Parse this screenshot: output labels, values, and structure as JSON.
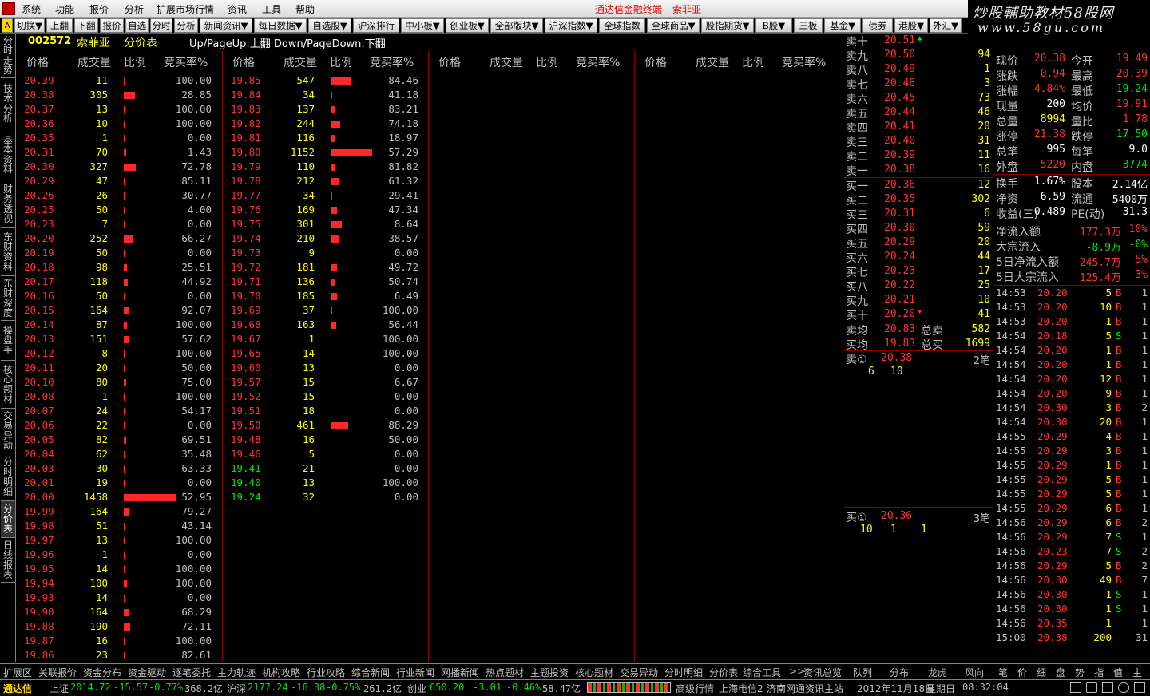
{
  "menu": {
    "items": [
      "系统",
      "功能",
      "报价",
      "分析",
      "扩展市场行情",
      "资讯",
      "工具",
      "帮助"
    ],
    "center_title": "通达信金融终端",
    "center_stock": "索菲亚"
  },
  "brand": {
    "line1": "炒股輔助教材58股网",
    "line2": "www.58gu.com"
  },
  "toolbar": {
    "items": [
      "切换▼",
      "上翻",
      "下翻",
      "报价",
      "自选",
      "分时",
      "分析",
      "新闻资讯▼",
      "每日数据▼",
      "自选股▼",
      "沪深排行",
      "中小板▼",
      "创业板▼",
      "全部版块▼",
      "沪深指数▼",
      "全球指数",
      "全球商品▼",
      "股指期货▼",
      "B股▼",
      "三板",
      "基金▼",
      "债券",
      "港股▼",
      "外汇▼"
    ]
  },
  "left_tabs": [
    "分时走势",
    "技术分析",
    "基本资料",
    "财务透视",
    "东财资料",
    "东财深度",
    "操盘手",
    "核心题材",
    "交易异动",
    "分时明细",
    "分价表",
    "日线报表"
  ],
  "header": {
    "code": "002572",
    "name": "索菲亚",
    "title": "分价表",
    "hint": "Up/PageUp:上翻 Down/PageDown:下翻"
  },
  "columns": {
    "price": "价格",
    "volume": "成交量",
    "ratio": "比例",
    "bid_rate": "竞买率%"
  },
  "col1": [
    {
      "p": "20.39",
      "v": "11",
      "r": "100.00",
      "c": "red",
      "b": 1
    },
    {
      "p": "20.38",
      "v": "305",
      "r": "28.85",
      "c": "red",
      "b": 14
    },
    {
      "p": "20.37",
      "v": "13",
      "r": "100.00",
      "c": "red",
      "b": 1
    },
    {
      "p": "20.36",
      "v": "10",
      "r": "100.00",
      "c": "red",
      "b": 1
    },
    {
      "p": "20.35",
      "v": "1",
      "r": "0.00",
      "c": "red",
      "b": 1
    },
    {
      "p": "20.31",
      "v": "70",
      "r": "1.43",
      "c": "red",
      "b": 3
    },
    {
      "p": "20.30",
      "v": "327",
      "r": "72.78",
      "c": "red",
      "b": 15
    },
    {
      "p": "20.29",
      "v": "47",
      "r": "85.11",
      "c": "red",
      "b": 2
    },
    {
      "p": "20.26",
      "v": "26",
      "r": "30.77",
      "c": "red",
      "b": 1
    },
    {
      "p": "20.25",
      "v": "50",
      "r": "4.00",
      "c": "red",
      "b": 2
    },
    {
      "p": "20.23",
      "v": "7",
      "r": "0.00",
      "c": "red",
      "b": 1
    },
    {
      "p": "20.20",
      "v": "252",
      "r": "66.27",
      "c": "red",
      "b": 11
    },
    {
      "p": "20.19",
      "v": "50",
      "r": "0.00",
      "c": "red",
      "b": 2
    },
    {
      "p": "20.18",
      "v": "98",
      "r": "25.51",
      "c": "red",
      "b": 4
    },
    {
      "p": "20.17",
      "v": "118",
      "r": "44.92",
      "c": "red",
      "b": 5
    },
    {
      "p": "20.16",
      "v": "50",
      "r": "0.00",
      "c": "red",
      "b": 2
    },
    {
      "p": "20.15",
      "v": "164",
      "r": "92.07",
      "c": "red",
      "b": 7
    },
    {
      "p": "20.14",
      "v": "87",
      "r": "100.00",
      "c": "red",
      "b": 4
    },
    {
      "p": "20.13",
      "v": "151",
      "r": "57.62",
      "c": "red",
      "b": 7
    },
    {
      "p": "20.12",
      "v": "8",
      "r": "100.00",
      "c": "red",
      "b": 1
    },
    {
      "p": "20.11",
      "v": "20",
      "r": "50.00",
      "c": "red",
      "b": 1
    },
    {
      "p": "20.10",
      "v": "80",
      "r": "75.00",
      "c": "red",
      "b": 3
    },
    {
      "p": "20.08",
      "v": "1",
      "r": "100.00",
      "c": "red",
      "b": 1
    },
    {
      "p": "20.07",
      "v": "24",
      "r": "54.17",
      "c": "red",
      "b": 1
    },
    {
      "p": "20.06",
      "v": "22",
      "r": "0.00",
      "c": "red",
      "b": 1
    },
    {
      "p": "20.05",
      "v": "82",
      "r": "69.51",
      "c": "red",
      "b": 3
    },
    {
      "p": "20.04",
      "v": "62",
      "r": "35.48",
      "c": "red",
      "b": 2
    },
    {
      "p": "20.03",
      "v": "30",
      "r": "63.33",
      "c": "red",
      "b": 1
    },
    {
      "p": "20.01",
      "v": "19",
      "r": "0.00",
      "c": "red",
      "b": 1
    },
    {
      "p": "20.00",
      "v": "1458",
      "r": "52.95",
      "c": "red",
      "b": 65
    },
    {
      "p": "19.99",
      "v": "164",
      "r": "79.27",
      "c": "red",
      "b": 7
    },
    {
      "p": "19.98",
      "v": "51",
      "r": "43.14",
      "c": "red",
      "b": 2
    },
    {
      "p": "19.97",
      "v": "13",
      "r": "100.00",
      "c": "red",
      "b": 1
    },
    {
      "p": "19.96",
      "v": "1",
      "r": "0.00",
      "c": "red",
      "b": 1
    },
    {
      "p": "19.95",
      "v": "14",
      "r": "100.00",
      "c": "red",
      "b": 1
    },
    {
      "p": "19.94",
      "v": "100",
      "r": "100.00",
      "c": "red",
      "b": 4
    },
    {
      "p": "19.93",
      "v": "14",
      "r": "0.00",
      "c": "red",
      "b": 1
    },
    {
      "p": "19.90",
      "v": "164",
      "r": "68.29",
      "c": "red",
      "b": 7
    },
    {
      "p": "19.88",
      "v": "190",
      "r": "72.11",
      "c": "red",
      "b": 8
    },
    {
      "p": "19.87",
      "v": "16",
      "r": "100.00",
      "c": "red",
      "b": 1
    },
    {
      "p": "19.86",
      "v": "23",
      "r": "82.61",
      "c": "red",
      "b": 1
    }
  ],
  "col2": [
    {
      "p": "19.85",
      "v": "547",
      "r": "84.46",
      "c": "red",
      "b": 26
    },
    {
      "p": "19.84",
      "v": "34",
      "r": "41.18",
      "c": "red",
      "b": 2
    },
    {
      "p": "19.83",
      "v": "137",
      "r": "83.21",
      "c": "red",
      "b": 6
    },
    {
      "p": "19.82",
      "v": "244",
      "r": "74.18",
      "c": "red",
      "b": 12
    },
    {
      "p": "19.81",
      "v": "116",
      "r": "18.97",
      "c": "red",
      "b": 5
    },
    {
      "p": "19.80",
      "v": "1152",
      "r": "57.29",
      "c": "red",
      "b": 52
    },
    {
      "p": "19.79",
      "v": "110",
      "r": "81.82",
      "c": "red",
      "b": 5
    },
    {
      "p": "19.78",
      "v": "212",
      "r": "61.32",
      "c": "red",
      "b": 10
    },
    {
      "p": "19.77",
      "v": "34",
      "r": "29.41",
      "c": "red",
      "b": 2
    },
    {
      "p": "19.76",
      "v": "169",
      "r": "47.34",
      "c": "red",
      "b": 8
    },
    {
      "p": "19.75",
      "v": "301",
      "r": "8.64",
      "c": "red",
      "b": 14
    },
    {
      "p": "19.74",
      "v": "210",
      "r": "38.57",
      "c": "red",
      "b": 10
    },
    {
      "p": "19.73",
      "v": "9",
      "r": "0.00",
      "c": "red",
      "b": 1
    },
    {
      "p": "19.72",
      "v": "181",
      "r": "49.72",
      "c": "red",
      "b": 8
    },
    {
      "p": "19.71",
      "v": "136",
      "r": "50.74",
      "c": "red",
      "b": 6
    },
    {
      "p": "19.70",
      "v": "185",
      "r": "6.49",
      "c": "red",
      "b": 8
    },
    {
      "p": "19.69",
      "v": "37",
      "r": "100.00",
      "c": "red",
      "b": 2
    },
    {
      "p": "19.68",
      "v": "163",
      "r": "56.44",
      "c": "red",
      "b": 7
    },
    {
      "p": "19.67",
      "v": "1",
      "r": "100.00",
      "c": "red",
      "b": 1
    },
    {
      "p": "19.65",
      "v": "14",
      "r": "100.00",
      "c": "red",
      "b": 1
    },
    {
      "p": "19.60",
      "v": "13",
      "r": "0.00",
      "c": "red",
      "b": 1
    },
    {
      "p": "19.57",
      "v": "15",
      "r": "6.67",
      "c": "red",
      "b": 1
    },
    {
      "p": "19.52",
      "v": "15",
      "r": "0.00",
      "c": "red",
      "b": 1
    },
    {
      "p": "19.51",
      "v": "18",
      "r": "0.00",
      "c": "red",
      "b": 1
    },
    {
      "p": "19.50",
      "v": "461",
      "r": "88.29",
      "c": "red",
      "b": 22
    },
    {
      "p": "19.48",
      "v": "16",
      "r": "50.00",
      "c": "red",
      "b": 1
    },
    {
      "p": "19.46",
      "v": "5",
      "r": "0.00",
      "c": "red",
      "b": 1
    },
    {
      "p": "19.41",
      "v": "21",
      "r": "0.00",
      "c": "green",
      "b": 1
    },
    {
      "p": "19.40",
      "v": "13",
      "r": "100.00",
      "c": "green",
      "b": 1
    },
    {
      "p": "19.24",
      "v": "32",
      "r": "0.00",
      "c": "green",
      "b": 1
    }
  ],
  "book": {
    "asks": [
      {
        "l": "卖十",
        "p": "20.51",
        "v": "",
        "arrow": "▲"
      },
      {
        "l": "卖九",
        "p": "20.50",
        "v": "94"
      },
      {
        "l": "卖八",
        "p": "20.49",
        "v": "1"
      },
      {
        "l": "卖七",
        "p": "20.48",
        "v": "3"
      },
      {
        "l": "卖六",
        "p": "20.45",
        "v": "73"
      },
      {
        "l": "卖五",
        "p": "20.44",
        "v": "46"
      },
      {
        "l": "卖四",
        "p": "20.41",
        "v": "20"
      },
      {
        "l": "卖三",
        "p": "20.40",
        "v": "31"
      },
      {
        "l": "卖二",
        "p": "20.39",
        "v": "11"
      },
      {
        "l": "卖一",
        "p": "20.38",
        "v": "16"
      }
    ],
    "bids": [
      {
        "l": "买一",
        "p": "20.36",
        "v": "12"
      },
      {
        "l": "买二",
        "p": "20.35",
        "v": "302"
      },
      {
        "l": "买三",
        "p": "20.31",
        "v": "6"
      },
      {
        "l": "买四",
        "p": "20.30",
        "v": "59"
      },
      {
        "l": "买五",
        "p": "20.29",
        "v": "20"
      },
      {
        "l": "买六",
        "p": "20.24",
        "v": "44"
      },
      {
        "l": "买七",
        "p": "20.23",
        "v": "17"
      },
      {
        "l": "买八",
        "p": "20.22",
        "v": "25"
      },
      {
        "l": "买九",
        "p": "20.21",
        "v": "10"
      },
      {
        "l": "买十",
        "p": "20.20",
        "v": "41",
        "arrow": "▼"
      }
    ],
    "avg_sell_label": "卖均",
    "avg_sell": "20.83",
    "total_sell_label": "总卖",
    "total_sell": "582",
    "avg_buy_label": "买均",
    "avg_buy": "19.83",
    "total_buy_label": "总买",
    "total_buy": "1699",
    "q_sell_label": "卖①",
    "q_sell_price": "20.38",
    "q_sell_count": "2笔",
    "q_sell_orders": [
      "6",
      "10"
    ],
    "q_buy_label": "买①",
    "q_buy_price": "20.36",
    "q_buy_count": "3笔",
    "q_buy_orders": [
      "10",
      "1",
      "1"
    ]
  },
  "quote": {
    "rows": [
      {
        "a": "现价",
        "av": "20.38",
        "ac": "red",
        "b": "今开",
        "bv": "19.49",
        "bc": "red"
      },
      {
        "a": "涨跌",
        "av": "0.94",
        "ac": "red",
        "b": "最高",
        "bv": "20.39",
        "bc": "red"
      },
      {
        "a": "涨幅",
        "av": "4.84%",
        "ac": "red",
        "b": "最低",
        "bv": "19.24",
        "bc": "green"
      },
      {
        "a": "现量",
        "av": "200",
        "ac": "white",
        "b": "均价",
        "bv": "19.91",
        "bc": "red"
      },
      {
        "a": "总量",
        "av": "8994",
        "ac": "yellow",
        "b": "量比",
        "bv": "1.78",
        "bc": "red"
      },
      {
        "a": "涨停",
        "av": "21.38",
        "ac": "red",
        "b": "跌停",
        "bv": "17.50",
        "bc": "green"
      },
      {
        "a": "总笔",
        "av": "995",
        "ac": "white",
        "b": "每笔",
        "bv": "9.0",
        "bc": "white"
      },
      {
        "a": "外盘",
        "av": "5220",
        "ac": "red",
        "b": "内盘",
        "bv": "3774",
        "bc": "green"
      },
      {
        "a": "换手",
        "av": "1.67%",
        "ac": "white",
        "b": "股本",
        "bv": "2.14亿",
        "bc": "white"
      },
      {
        "a": "净资",
        "av": "6.59",
        "ac": "white",
        "b": "流通",
        "bv": "5400万",
        "bc": "white"
      },
      {
        "a": "收益(三)",
        "av": "0.489",
        "ac": "white",
        "b": "PE(动)",
        "bv": "31.3",
        "bc": "white"
      }
    ],
    "flow": [
      {
        "l": "净流入额",
        "v": "177.3万",
        "vc": "red",
        "p": "10%",
        "pc": "red"
      },
      {
        "l": "大宗流入",
        "v": "-8.9万",
        "vc": "green",
        "p": "-0%",
        "pc": "green"
      },
      {
        "l": "5日净流入额",
        "v": "245.7万",
        "vc": "red",
        "p": "5%",
        "pc": "red"
      },
      {
        "l": "5日大宗流入",
        "v": "125.4万",
        "vc": "red",
        "p": "3%",
        "pc": "red"
      }
    ]
  },
  "ticks": [
    {
      "t": "14:53",
      "p": "20.20",
      "v": "5",
      "d": "B",
      "n": "1"
    },
    {
      "t": "14:53",
      "p": "20.20",
      "v": "10",
      "d": "B",
      "n": "1"
    },
    {
      "t": "14:53",
      "p": "20.20",
      "v": "1",
      "d": "B",
      "n": "1"
    },
    {
      "t": "14:54",
      "p": "20.18",
      "v": "5",
      "d": "S",
      "n": "1"
    },
    {
      "t": "14:54",
      "p": "20.20",
      "v": "1",
      "d": "B",
      "n": "1"
    },
    {
      "t": "14:54",
      "p": "20.20",
      "v": "1",
      "d": "B",
      "n": "1"
    },
    {
      "t": "14:54",
      "p": "20.20",
      "v": "12",
      "d": "B",
      "n": "1"
    },
    {
      "t": "14:54",
      "p": "20.20",
      "v": "9",
      "d": "B",
      "n": "1"
    },
    {
      "t": "14:54",
      "p": "20.30",
      "v": "3",
      "d": "B",
      "n": "2"
    },
    {
      "t": "14:54",
      "p": "20.30",
      "v": "20",
      "d": "B",
      "n": "1"
    },
    {
      "t": "14:55",
      "p": "20.29",
      "v": "4",
      "d": "B",
      "n": "1"
    },
    {
      "t": "14:55",
      "p": "20.29",
      "v": "3",
      "d": "B",
      "n": "1"
    },
    {
      "t": "14:55",
      "p": "20.29",
      "v": "1",
      "d": "B",
      "n": "1"
    },
    {
      "t": "14:55",
      "p": "20.29",
      "v": "5",
      "d": "B",
      "n": "1"
    },
    {
      "t": "14:55",
      "p": "20.29",
      "v": "5",
      "d": "B",
      "n": "1"
    },
    {
      "t": "14:55",
      "p": "20.29",
      "v": "6",
      "d": "B",
      "n": "1"
    },
    {
      "t": "14:56",
      "p": "20.29",
      "v": "6",
      "d": "B",
      "n": "2"
    },
    {
      "t": "14:56",
      "p": "20.29",
      "v": "7",
      "d": "S",
      "n": "1"
    },
    {
      "t": "14:56",
      "p": "20.23",
      "v": "7",
      "d": "S",
      "n": "2"
    },
    {
      "t": "14:56",
      "p": "20.29",
      "v": "5",
      "d": "B",
      "n": "2"
    },
    {
      "t": "14:56",
      "p": "20.30",
      "v": "49",
      "d": "B",
      "n": "7"
    },
    {
      "t": "14:56",
      "p": "20.30",
      "v": "1",
      "d": "S",
      "n": "1"
    },
    {
      "t": "14:56",
      "p": "20.30",
      "v": "1",
      "d": "S",
      "n": "1"
    },
    {
      "t": "14:56",
      "p": "20.35",
      "v": "1",
      "d": "",
      "n": "1"
    },
    {
      "t": "15:00",
      "p": "20.38",
      "v": "200",
      "d": "",
      "n": "31"
    }
  ],
  "bottom_tabs": [
    "扩展区",
    "关联报价",
    "资金分布",
    "资金驱动",
    "逐笔委托",
    "主力轨迹",
    "机构攻略",
    "行业攻略",
    "综合新闻",
    "行业新闻",
    "网播新闻",
    "热点题材",
    "主题投资",
    "核心题材",
    "交易异动",
    "分时明细",
    "分价表",
    "综合工具",
    ">>",
    "资讯总览"
  ],
  "right_tabs": [
    "队列",
    "分布",
    "龙虎",
    "风向"
  ],
  "mini_tabs": [
    "笔",
    "价",
    "细",
    "盘",
    "势",
    "指",
    "值",
    "主"
  ],
  "status": {
    "app": "通达信",
    "sh_label": "上证",
    "sh_val": "2014.72",
    "sh_chg": "-15.57",
    "sh_pct": "-0.77%",
    "sh_amt": "368.2亿",
    "sz_label": "沪深",
    "sz_val": "2177.24",
    "sz_chg": "-16.38",
    "sz_pct": "-0.75%",
    "sz_amt": "261.2亿",
    "cy_label": "创业",
    "cy_val": "650.20",
    "cy_chg": "-3.01",
    "cy_pct": "-0.46%",
    "cy_amt": "58.47亿",
    "server": "高级行情_上海电信2",
    "news": "济南网通资讯主站",
    "date": "2012年11月18日",
    "weekday": "星期日",
    "time": "08:32:04"
  }
}
